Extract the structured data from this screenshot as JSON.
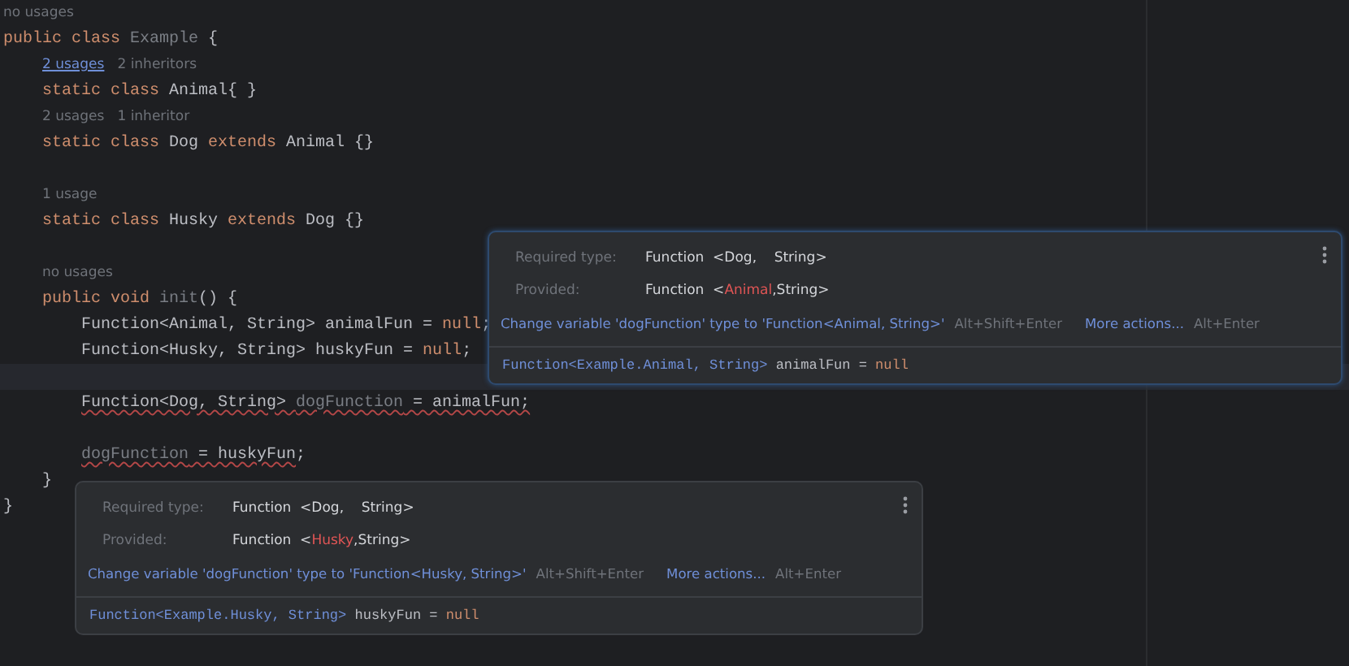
{
  "editor": {
    "lines": [
      {
        "kind": "hint",
        "current": false,
        "parts": [
          {
            "text": "no usages",
            "link": false
          }
        ]
      },
      {
        "kind": "code",
        "current": false,
        "tokens": [
          {
            "t": "public class ",
            "kind": "keyword"
          },
          {
            "t": "Example",
            "kind": "unused"
          },
          {
            "t": " {",
            "kind": "plain"
          }
        ],
        "children": [
          {
            "kind": "hint",
            "current": false,
            "parts": [
              {
                "text": "2 usages",
                "link": true
              },
              {
                "text": "2 inheritors",
                "link": false
              }
            ]
          },
          {
            "kind": "code",
            "current": false,
            "tokens": [
              {
                "t": "static class ",
                "kind": "keyword"
              },
              {
                "t": "Animal{ }",
                "kind": "plain"
              }
            ]
          },
          {
            "kind": "hint",
            "current": false,
            "parts": [
              {
                "text": "2 usages",
                "link": false
              },
              {
                "text": "1 inheritor",
                "link": false
              }
            ]
          },
          {
            "kind": "code",
            "current": false,
            "tokens": [
              {
                "t": "static class ",
                "kind": "keyword"
              },
              {
                "t": "Dog ",
                "kind": "plain"
              },
              {
                "t": "extends ",
                "kind": "keyword"
              },
              {
                "t": "Animal {}",
                "kind": "plain"
              }
            ]
          },
          {
            "kind": "blank",
            "current": false
          },
          {
            "kind": "hint",
            "current": false,
            "parts": [
              {
                "text": "1 usage",
                "link": false
              }
            ]
          },
          {
            "kind": "code",
            "current": false,
            "tokens": [
              {
                "t": "static class ",
                "kind": "keyword"
              },
              {
                "t": "Husky ",
                "kind": "plain"
              },
              {
                "t": "extends ",
                "kind": "keyword"
              },
              {
                "t": "Dog {}",
                "kind": "plain"
              }
            ]
          },
          {
            "kind": "blank",
            "current": false
          },
          {
            "kind": "hint",
            "current": false,
            "parts": [
              {
                "text": "no usages",
                "link": false
              }
            ]
          },
          {
            "kind": "code",
            "current": false,
            "tokens": [
              {
                "t": "public void ",
                "kind": "keyword"
              },
              {
                "t": "init",
                "kind": "unused"
              },
              {
                "t": "() {",
                "kind": "plain"
              }
            ],
            "children": [
              {
                "kind": "code",
                "current": false,
                "tokens": [
                  {
                    "t": "Function<Animal, String> animalFun = ",
                    "kind": "plain"
                  },
                  {
                    "t": "null",
                    "kind": "keyword"
                  },
                  {
                    "t": ";",
                    "kind": "plain"
                  }
                ]
              },
              {
                "kind": "code",
                "current": false,
                "tokens": [
                  {
                    "t": "Function<Husky, String> huskyFun = ",
                    "kind": "plain"
                  },
                  {
                    "t": "null",
                    "kind": "keyword"
                  },
                  {
                    "t": ";",
                    "kind": "plain"
                  }
                ]
              },
              {
                "kind": "blank",
                "current": true
              },
              {
                "kind": "code",
                "current": false,
                "tokens": [
                  {
                    "t": "Function<Dog, String> ",
                    "kind": "plain",
                    "error": true
                  },
                  {
                    "t": "dogFunction",
                    "kind": "unused",
                    "error": true
                  },
                  {
                    "t": " = animalFun;",
                    "kind": "plain",
                    "error": true
                  }
                ]
              },
              {
                "kind": "blank",
                "current": false
              },
              {
                "kind": "code",
                "current": false,
                "tokens": [
                  {
                    "t": "dogFunction",
                    "kind": "unused",
                    "error": true
                  },
                  {
                    "t": " = huskyFun",
                    "kind": "plain",
                    "error": true
                  },
                  {
                    "t": ";",
                    "kind": "plain",
                    "error": false
                  }
                ]
              }
            ]
          },
          {
            "kind": "code",
            "current": false,
            "tokens": [
              {
                "t": "}",
                "kind": "plain"
              }
            ]
          }
        ]
      },
      {
        "kind": "code",
        "current": false,
        "tokens": [
          {
            "t": "}",
            "kind": "plain"
          }
        ]
      }
    ]
  },
  "popups": [
    {
      "focused": true,
      "required": {
        "label": "Required type:",
        "parts": [
          {
            "text": "Function  <Dog,    String>",
            "mismatch": false
          }
        ]
      },
      "provided": {
        "label": "Provided:",
        "parts": [
          {
            "text": "Function  <",
            "mismatch": false
          },
          {
            "text": "Animal",
            "mismatch": true
          },
          {
            "text": ",String>",
            "mismatch": false
          }
        ]
      },
      "fix": "Change variable 'dogFunction' type to 'Function<Animal, String>'",
      "fix_shortcut": "Alt+Shift+Enter",
      "more": "More actions...",
      "more_shortcut": "Alt+Enter",
      "preview": [
        {
          "t": "Function<Example.Animal, String>",
          "kind": "type"
        },
        {
          "t": " animalFun = ",
          "kind": "plain"
        },
        {
          "t": "null",
          "kind": "keyword"
        }
      ]
    },
    {
      "focused": false,
      "required": {
        "label": "Required type:",
        "parts": [
          {
            "text": "Function  <Dog,    String>",
            "mismatch": false
          }
        ]
      },
      "provided": {
        "label": "Provided:",
        "parts": [
          {
            "text": "Function  <",
            "mismatch": false
          },
          {
            "text": "Husky",
            "mismatch": true
          },
          {
            "text": ",String>",
            "mismatch": false
          }
        ]
      },
      "fix": "Change variable 'dogFunction' type to 'Function<Husky, String>'",
      "fix_shortcut": "Alt+Shift+Enter",
      "more": "More actions...",
      "more_shortcut": "Alt+Enter",
      "preview": [
        {
          "t": "Function<Example.Husky, String>",
          "kind": "type"
        },
        {
          "t": " huskyFun = ",
          "kind": "plain"
        },
        {
          "t": "null",
          "kind": "keyword"
        }
      ]
    }
  ]
}
